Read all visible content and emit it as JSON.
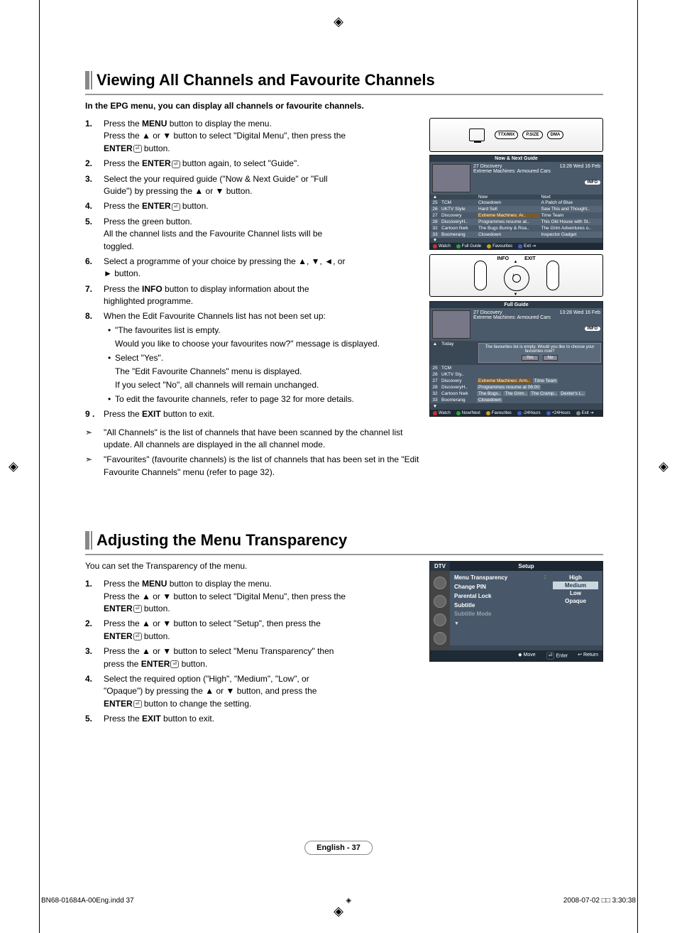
{
  "crop_glyph": "◈",
  "section1": {
    "title": "Viewing All Channels and Favourite Channels",
    "intro": "In the EPG menu, you can display all channels or favourite channels.",
    "steps": [
      {
        "num": "1.",
        "lines": [
          "Press the <b>MENU</b> button to display the menu.",
          "Press the ▲ or ▼ button to select \"Digital Menu\", then press the",
          "<b>ENTER</b><span class='enter-glyph'>⏎</span> button."
        ]
      },
      {
        "num": "2.",
        "lines": [
          "Press the <b>ENTER</b><span class='enter-glyph'>⏎</span> button again, to select \"Guide\"."
        ]
      },
      {
        "num": "3.",
        "lines": [
          "Select the your required guide (\"Now & Next Guide\" or \"Full",
          "Guide\") by pressing the ▲ or ▼ button."
        ]
      },
      {
        "num": "4.",
        "lines": [
          "Press the <b>ENTER</b><span class='enter-glyph'>⏎</span> button."
        ]
      },
      {
        "num": "5.",
        "lines": [
          "Press the green button.",
          "All the channel lists and the Favourite Channel lists will be",
          "toggled."
        ]
      },
      {
        "num": "6.",
        "lines": [
          "Select a programme of your choice by pressing the ▲, ▼, ◄, or",
          "► button."
        ]
      },
      {
        "num": "7.",
        "lines": [
          "Press the <b>INFO</b> button to display information about the",
          "highlighted programme."
        ]
      },
      {
        "num": "8.",
        "lines": [
          "When the Edit Favourite Channels list has not been set up:"
        ],
        "subs": [
          "\"The favourites list is empty.",
          "Would you like to choose your favourites now?\" message is displayed.",
          "Select \"Yes\".",
          "The \"Edit Favourite Channels\" menu is displayed.",
          "If you select \"No\", all channels will remain unchanged.",
          "To edit the favourite channels, refer to page 32 for more details."
        ]
      },
      {
        "num": "9 .",
        "lines": [
          "Press the <b>EXIT</b> button to exit."
        ]
      }
    ],
    "notes": [
      "\"All Channels\" is the list of channels that have been scanned by the channel list update. All channels are displayed in the all channel mode.",
      "\"Favourites\" (favourite channels) is the list of channels that has been set in the \"Edit Favourite Channels\" menu (refer to page 32)."
    ]
  },
  "remote": {
    "top_buttons": [
      "TTX/MIX",
      "P.SIZE",
      "DMA"
    ],
    "dpad": {
      "center_glyph": "i",
      "arc_left": "INFO",
      "arc_right": "EXIT"
    }
  },
  "epg1": {
    "title": "Now & Next Guide",
    "channel_line": "27 Discovery",
    "time_line": "13:28 Wed 16 Feb",
    "prog_line": "Extreme Machines: Armoured Cars",
    "info_label": "INFO",
    "cols": {
      "now": "Now",
      "next": "Next"
    },
    "rows": [
      {
        "num": "25",
        "name": "TCM",
        "now": "Closedown",
        "next": "A Patch of Blue"
      },
      {
        "num": "26",
        "name": "UKTV Style",
        "now": "Hard Sell",
        "next": "Saw This and Thought.."
      },
      {
        "num": "27",
        "name": "Discovery",
        "now": "Extreme Machines: Ar..",
        "next": "Time Team",
        "hl": true
      },
      {
        "num": "28",
        "name": "DiscoveryH..",
        "now": "Programmes resume at..",
        "next": "This Old House with St.."
      },
      {
        "num": "32",
        "name": "Cartoon Nwk",
        "now": "The Bugs Bunny & Roa..",
        "next": "The Grim Adventures o.."
      },
      {
        "num": "33",
        "name": "Boomerang",
        "now": "Closedown",
        "next": "Inspector Gadget"
      }
    ],
    "footer": [
      {
        "color": "#cc3030",
        "label": "Watch"
      },
      {
        "color": "#30a040",
        "label": "Full Guide"
      },
      {
        "color": "#c8a020",
        "label": "Favourites"
      },
      {
        "color": "#4060c0",
        "label": "Exit",
        "suffix": "⇥"
      }
    ]
  },
  "epg2": {
    "title": "Full Guide",
    "channel_line": "27 Discovery",
    "time_line": "13:28 Wed 16 Feb",
    "prog_line": "Extreme Machines: Armoured Cars",
    "info_label": "INFO",
    "today_label": "Today",
    "msg": "The favourites list is empty. Would you like to choose your favourites now?",
    "yes": "Yes",
    "no": "No",
    "rows": [
      {
        "num": "25",
        "name": "TCM",
        "blocks": []
      },
      {
        "num": "26",
        "name": "UKTV Sty..",
        "blocks": []
      },
      {
        "num": "27",
        "name": "Discovery",
        "blocks": [
          "Extreme Machines: Arm..",
          "Time Team"
        ],
        "hl": true
      },
      {
        "num": "28",
        "name": "DiscoveryH..",
        "blocks": [
          "Programmes resume at 06:00"
        ]
      },
      {
        "num": "32",
        "name": "Cartoon Nwk",
        "blocks": [
          "The Bugs..",
          "The Grim..",
          "The Cramp..",
          "Dexter's L.."
        ]
      },
      {
        "num": "33",
        "name": "Boomerang",
        "blocks": [
          "Closedown"
        ]
      }
    ],
    "footer": [
      {
        "color": "#cc3030",
        "label": "Watch"
      },
      {
        "color": "#30a040",
        "label": "Now/Next"
      },
      {
        "color": "#c8a020",
        "label": "Favourites"
      },
      {
        "color": "#4060c0",
        "label": "-24Hours"
      },
      {
        "color": "#4060c0",
        "label": "+24Hours"
      },
      {
        "color": "#888",
        "label": "Exit",
        "suffix": "⇥"
      }
    ]
  },
  "section2": {
    "title": "Adjusting the Menu Transparency",
    "intro": "You can set the Transparency of the menu.",
    "steps": [
      {
        "num": "1.",
        "lines": [
          "Press the <b>MENU</b> button to display the menu.",
          "Press the ▲ or ▼ button to select \"Digital Menu\", then press the",
          "<b>ENTER</b><span class='enter-glyph'>⏎</span> button."
        ]
      },
      {
        "num": "2.",
        "lines": [
          "Press the ▲ or ▼ button to select \"Setup\", then press the",
          "<b>ENTER</b><span class='enter-glyph'>⏎</span> button."
        ]
      },
      {
        "num": "3.",
        "lines": [
          "Press the ▲ or ▼ button to select \"Menu Transparency\" then",
          "press the <b>ENTER</b><span class='enter-glyph'>⏎</span> button."
        ]
      },
      {
        "num": "4.",
        "lines": [
          "Select the required option (\"High\", \"Medium\", \"Low\", or",
          "\"Opaque\") by pressing the ▲ or ▼ button, and press the",
          "<b>ENTER</b><span class='enter-glyph'>⏎</span> button to change the setting."
        ]
      },
      {
        "num": "5.",
        "lines": [
          "Press the <b>EXIT</b> button to exit."
        ]
      }
    ]
  },
  "dtv": {
    "tab_left": "DTV",
    "tab_title": "Setup",
    "items": [
      "Menu Transparency",
      "Change PIN",
      "Parental Lock",
      "Subtitle",
      "Subtitle Mode"
    ],
    "colon": ":",
    "options": [
      "High",
      "Medium",
      "Low",
      "Opaque"
    ],
    "selected_index": 1,
    "footer": {
      "move": "Move",
      "enter": "Enter",
      "return": "Return"
    }
  },
  "footer_page": "English - 37",
  "indd": {
    "left": "BN68-01684A-00Eng.indd   37",
    "right": "2008-07-02   □□ 3:30:38"
  }
}
